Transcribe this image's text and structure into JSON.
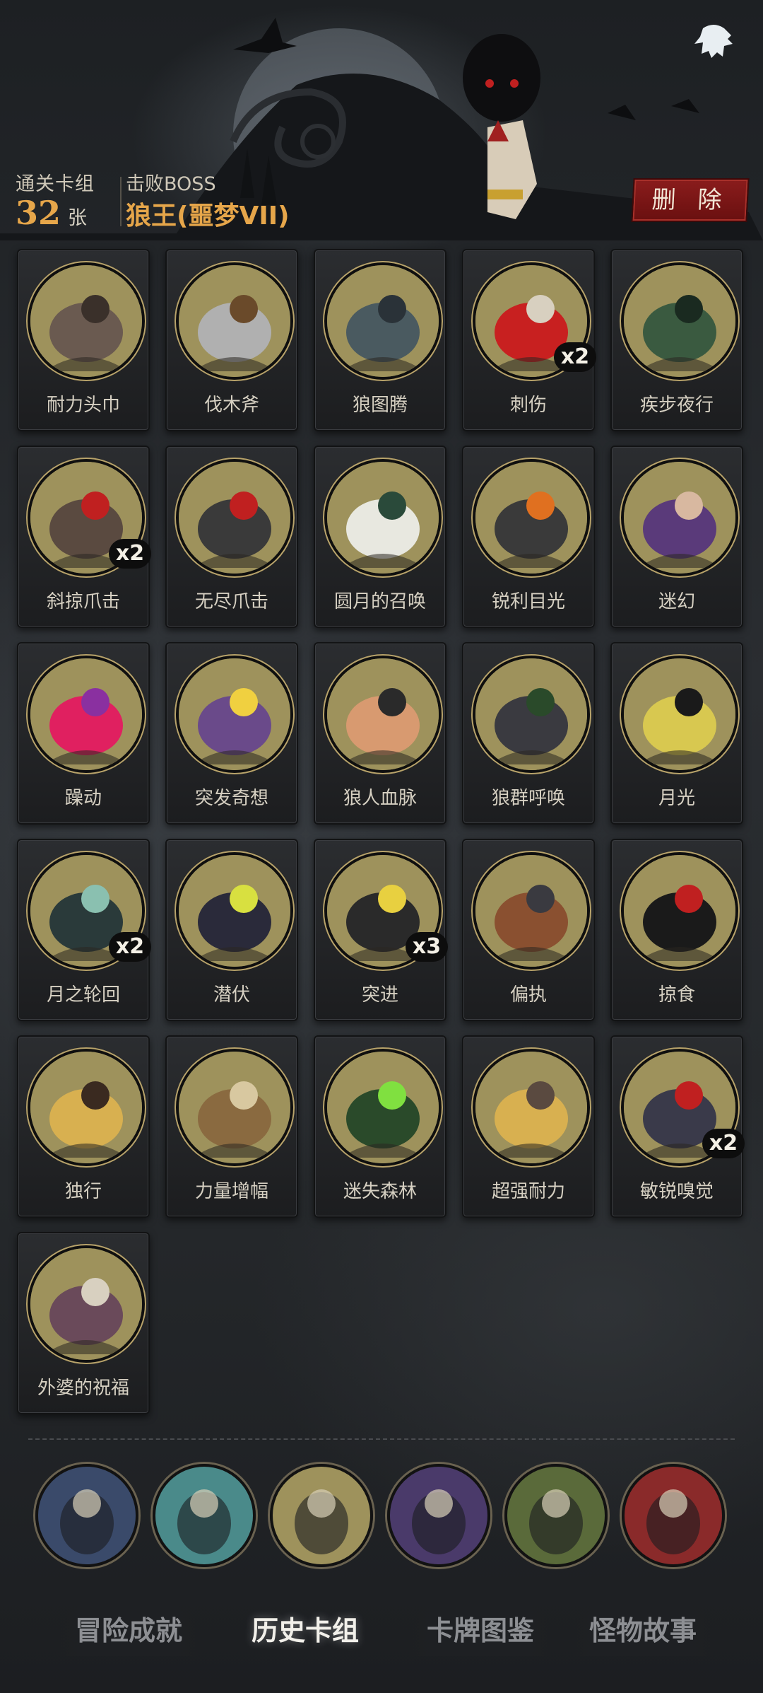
{
  "header": {
    "stats_label": "通关卡组",
    "stats_count": "32",
    "stats_unit": "张",
    "boss_label": "击败BOSS",
    "boss_name": "狼王(噩梦VII)",
    "delete_label": "删 除"
  },
  "cards": [
    {
      "name": "耐力头巾",
      "count": "",
      "icon": "bandana-icon"
    },
    {
      "name": "伐木斧",
      "count": "",
      "icon": "axe-icon"
    },
    {
      "name": "狼图腾",
      "count": "",
      "icon": "wolf-totem-icon"
    },
    {
      "name": "刺伤",
      "count": "x2",
      "icon": "dagger-icon"
    },
    {
      "name": "疾步夜行",
      "count": "",
      "icon": "werewolf-run-icon"
    },
    {
      "name": "斜掠爪击",
      "count": "x2",
      "icon": "claw-slash-icon"
    },
    {
      "name": "无尽爪击",
      "count": "",
      "icon": "claw-icon"
    },
    {
      "name": "圆月的召唤",
      "count": "",
      "icon": "full-moon-forest-icon"
    },
    {
      "name": "锐利目光",
      "count": "",
      "icon": "wolf-face-icon"
    },
    {
      "name": "迷幻",
      "count": "",
      "icon": "witch-icon"
    },
    {
      "name": "躁动",
      "count": "",
      "icon": "frenzy-icon"
    },
    {
      "name": "突发奇想",
      "count": "",
      "icon": "idea-icon"
    },
    {
      "name": "狼人血脉",
      "count": "",
      "icon": "hand-icon"
    },
    {
      "name": "狼群呼唤",
      "count": "",
      "icon": "wolf-pack-icon"
    },
    {
      "name": "月光",
      "count": "",
      "icon": "moon-howl-icon"
    },
    {
      "name": "月之轮回",
      "count": "x2",
      "icon": "moon-phases-icon"
    },
    {
      "name": "潜伏",
      "count": "",
      "icon": "lurking-wolf-icon"
    },
    {
      "name": "突进",
      "count": "x3",
      "icon": "pounce-icon"
    },
    {
      "name": "偏执",
      "count": "",
      "icon": "wolf-bear-icon"
    },
    {
      "name": "掠食",
      "count": "",
      "icon": "predator-icon"
    },
    {
      "name": "独行",
      "count": "",
      "icon": "lone-boy-icon"
    },
    {
      "name": "力量增幅",
      "count": "",
      "icon": "log-icon"
    },
    {
      "name": "迷失森林",
      "count": "",
      "icon": "lost-forest-icon"
    },
    {
      "name": "超强耐力",
      "count": "",
      "icon": "endurance-icon"
    },
    {
      "name": "敏锐嗅觉",
      "count": "x2",
      "icon": "wolf-sniff-icon"
    },
    {
      "name": "外婆的祝福",
      "count": "",
      "icon": "grandma-icon"
    }
  ],
  "boss_icons": [
    {
      "name": "werewolf-boss-icon",
      "color": "#3a4a6a"
    },
    {
      "name": "gargoyle-boss-icon",
      "color": "#4a8a8a"
    },
    {
      "name": "hourglass-icon",
      "color": "#9e925c"
    },
    {
      "name": "spellbook-icon",
      "color": "#4a3a6a"
    },
    {
      "name": "zombie-boss-icon",
      "color": "#5a6a3a"
    },
    {
      "name": "clown-boss-icon",
      "color": "#8a2a2a"
    }
  ],
  "tabs": [
    "冒险成就",
    "历史卡组",
    "卡牌图鉴",
    "怪物故事"
  ],
  "colors": {
    "accent": "#e6a64a",
    "delete": "#8a1c1c",
    "card_art": "#9e925c"
  }
}
